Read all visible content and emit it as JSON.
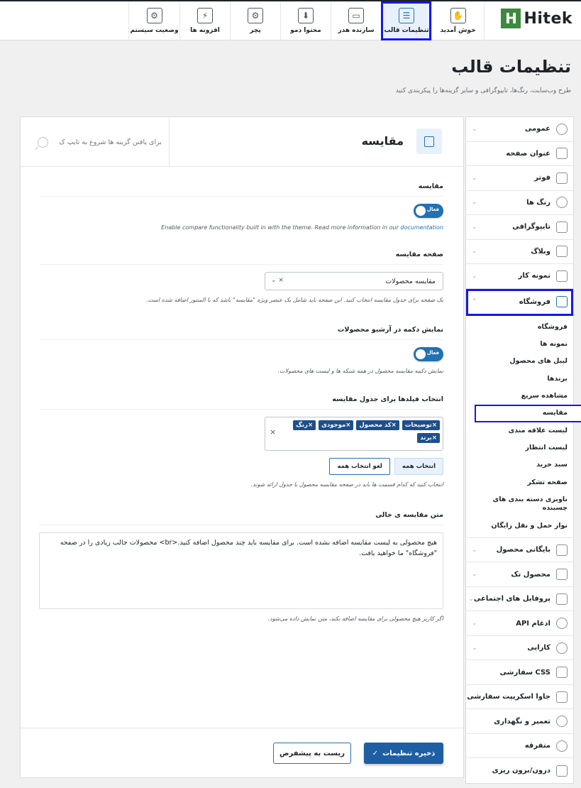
{
  "brand": {
    "name": "Hitek",
    "mark": "H"
  },
  "nav": {
    "tabs": [
      {
        "label": "خوش آمدید",
        "icon": "handshake-icon",
        "glyph": "✋"
      },
      {
        "label": "تنظیمات قالب",
        "icon": "sliders-icon",
        "glyph": "☰",
        "active": true
      },
      {
        "label": "سازنده هدر",
        "icon": "header-builder-icon",
        "glyph": "▭"
      },
      {
        "label": "محتوا دمو",
        "icon": "download-icon",
        "glyph": "⬇"
      },
      {
        "label": "پچر",
        "icon": "patcher-icon",
        "glyph": "⚙"
      },
      {
        "label": "افزونه ها",
        "icon": "plugin-icon",
        "glyph": "⚡"
      },
      {
        "label": "وضعیت سیستم",
        "icon": "system-status-icon",
        "glyph": "⚙"
      }
    ]
  },
  "page": {
    "title": "تنظیمات قالب",
    "subtitle": "طرح وب‌سایت، رنگ‌ها، تایپوگرافی و سایر گزینه‌ها را پیکربندی کنید"
  },
  "sidebar": {
    "items_top": [
      {
        "label": "عمومی",
        "icon": "gear-icon",
        "chevron": "⌄"
      },
      {
        "label": "عنوان صفحه",
        "icon": "page-title-icon",
        "chevron": ""
      },
      {
        "label": "فوتر",
        "icon": "footer-icon",
        "chevron": "⌄"
      },
      {
        "label": "رنگ ها",
        "icon": "palette-icon",
        "chevron": "⌄"
      },
      {
        "label": "تایپوگرافی",
        "icon": "typography-icon",
        "chevron": "⌄"
      },
      {
        "label": "وبلاگ",
        "icon": "blog-icon",
        "chevron": "⌄"
      },
      {
        "label": "نمونه کار",
        "icon": "portfolio-icon",
        "chevron": "⌄"
      }
    ],
    "shop": {
      "label": "فروشگاه",
      "icon": "shopping-bag-icon",
      "chevron": "⌃"
    },
    "shop_sub": [
      "فروشگاه",
      "نمونه ها",
      "لیبل های محصول",
      "برندها",
      "مشاهده سریع",
      "مقایسه",
      "لیست علاقه مندی",
      "لیست انتظار",
      "سبد خرید",
      "صفحه تشکر",
      "ناوبری دسته بندی های چسبنده",
      "نوار حمل و نقل رایگان"
    ],
    "shop_sub_active": "مقایسه",
    "items_bottom": [
      {
        "label": "بایگانی محصول",
        "icon": "archive-icon",
        "chevron": "⌄"
      },
      {
        "label": "محصول تک",
        "icon": "single-product-icon",
        "chevron": "⌄"
      },
      {
        "label": "پروفایل های اجتماعی",
        "icon": "social-icon",
        "chevron": "⌄"
      },
      {
        "label": "ادغام API",
        "icon": "api-icon",
        "chevron": "⌄"
      },
      {
        "label": "کارایی",
        "icon": "performance-icon",
        "chevron": "⌄"
      },
      {
        "label": "CSS سفارشی",
        "icon": "css-icon",
        "chevron": ""
      },
      {
        "label": "جاوا اسکریپت سفارشی",
        "icon": "js-icon",
        "chevron": ""
      },
      {
        "label": "تعمیر و نگهداری",
        "icon": "maintenance-icon",
        "chevron": ""
      },
      {
        "label": "متفرقه",
        "icon": "misc-icon",
        "chevron": ""
      },
      {
        "label": "درون/برون ریزی",
        "icon": "import-export-icon",
        "chevron": ""
      }
    ]
  },
  "section": {
    "title": "مقایسه",
    "search_placeholder": "برای یافتن گزینه ها شروع به تایپ ک"
  },
  "fields": {
    "compare": {
      "label": "مقایسه",
      "toggle": "فعال",
      "desc_prefix": "Enable compare functionality built in with the theme. Read more information in our ",
      "desc_link": "documentation"
    },
    "compare_page": {
      "label": "صفحه مقایسه",
      "value": "مقایسه محصولات",
      "controls": "⌄  ×",
      "desc": "یک صفحه برای جدول مقایسه انتخاب کنید. این صفحه باید شامل یک عنصر ویژه \"مقایسه\" باشد که با المنتور اضافه شده است."
    },
    "archive_button": {
      "label": "نمایش دکمه در آرشیو محصولات",
      "toggle": "فعال",
      "desc": "نمایش دکمه مقایسه محصول در همه شبکه ها و لیست های محصولات."
    },
    "table_fields": {
      "label": "انتخاب فیلدها برای جدول مقایسه",
      "chips": [
        "×توضیحات",
        "×کد محصول",
        "×موجودی",
        "×رنگ",
        "×برند"
      ],
      "clear": "×",
      "select_all": "انتخاب همه",
      "deselect_all": "لغو انتخاب همه",
      "desc": "انتخاب کنید که کدام قسمت ها باید در صفحه مقایسه محصول با جدول ارائه شوند."
    },
    "empty_text": {
      "label": "متن مقایسه ی خالی",
      "value": "هیچ محصولی به لیست مقایسه اضافه نشده است. برای مقایسه باید چند محصول اضافه کنید.<br> محصولات جالب زیادی را در صفحه \"فروشگاه\" ما خواهید یافت.",
      "desc": "اگر کاربر هیچ محصولی برای مقایسه اضافه نکند، متن نمایش داده می‌شود."
    }
  },
  "footer": {
    "save": "ذخیره تنظیمات",
    "save_icon": "✓",
    "reset": "ریست به پیشفرض"
  },
  "colors": {
    "accent": "#2271b1",
    "highlight": "#1518e6",
    "brand": "#3d8a3c"
  }
}
